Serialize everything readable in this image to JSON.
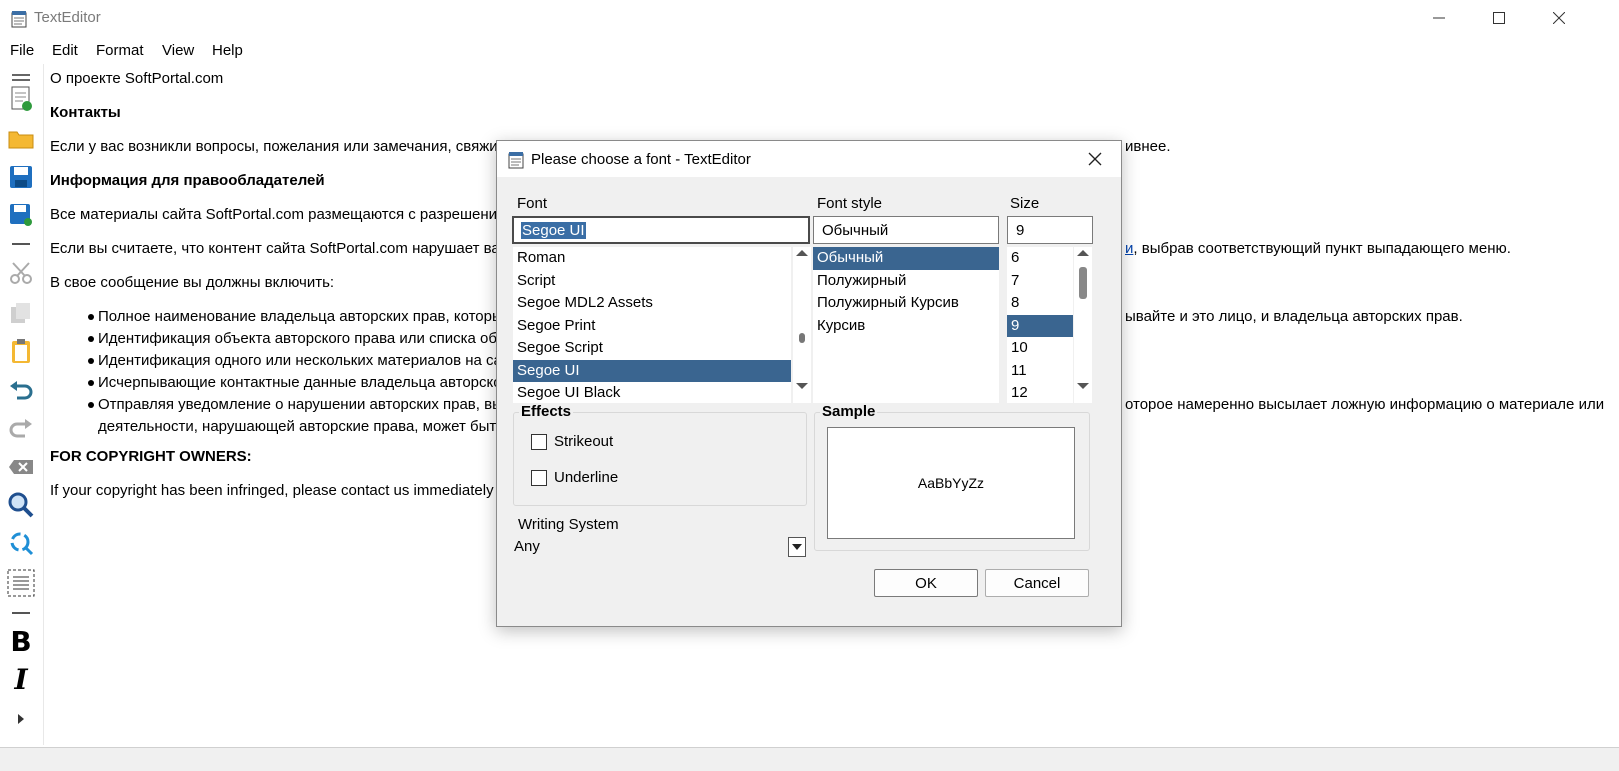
{
  "window": {
    "title": "TextEditor"
  },
  "menu": [
    "File",
    "Edit",
    "Format",
    "View",
    "Help"
  ],
  "toolbar_icons": [
    "hamburger-icon",
    "new-document-icon",
    "open-folder-icon",
    "save-icon",
    "save-as-icon",
    "cut-icon",
    "copy-icon",
    "paste-icon",
    "undo-icon",
    "redo-icon",
    "clear-icon",
    "find-icon",
    "replace-icon",
    "select-all-icon",
    "bold-icon",
    "italic-icon",
    "more-icon"
  ],
  "document": {
    "line1": "О проекте SoftPortal.com",
    "heading1": "Контакты",
    "para1_start": "Если у вас возникли вопросы, пожелания или замечания, свяжит",
    "para1_end": "ивнее.",
    "heading2": "Информация для правообладателей",
    "para2_start": "Все материалы сайта SoftPortal.com размещаются с разрешения",
    "para3_start": "Если вы считаете, что контент сайта SoftPortal.com нарушает ваш",
    "para3_link": "и",
    "para3_end": ", выбрав соответствующий пункт выпадающего меню.",
    "para4": "В свое сообщение вы должны включить:",
    "bullets": [
      {
        "start": "Полное наименование владельца авторских прав, которы",
        "end": "ывайте и это лицо, и владельца авторских прав."
      },
      {
        "start": "Идентификация объекта авторского права или списка об",
        "end": ""
      },
      {
        "start": "Идентификация одного или нескольких материалов на са",
        "end": ""
      },
      {
        "start": "Исчерпывающие контактные данные владельца авторско",
        "end": ""
      },
      {
        "start": "Отправляя уведомление о нарушении авторских прав, вы",
        "end": "оторое намеренно высылает ложную информацию о материале или"
      }
    ],
    "bullet5_line2": "деятельности, нарушающей авторские права, может быть",
    "heading3": "FOR COPYRIGHT OWNERS:",
    "para5_start": "If your copyright has been infringed, please contact us immediately"
  },
  "dialog": {
    "title": "Please choose a font - TextEditor",
    "font_label": "Font",
    "font_value": "Segoe UI",
    "font_list": [
      "Roman",
      "Script",
      "Segoe MDL2 Assets",
      "Segoe Print",
      "Segoe Script",
      "Segoe UI",
      "Segoe UI Black"
    ],
    "font_selected": "Segoe UI",
    "style_label": "Font style",
    "style_value": "Обычный",
    "style_list": [
      "Обычный",
      "Полужирный",
      "Полужирный Курсив",
      "Курсив"
    ],
    "style_selected": "Обычный",
    "size_label": "Size",
    "size_value": "9",
    "size_list": [
      "6",
      "7",
      "8",
      "9",
      "10",
      "11",
      "12"
    ],
    "size_selected": "9",
    "effects_label": "Effects",
    "strikeout_label": "Strikeout",
    "strikeout_checked": false,
    "underline_label": "Underline",
    "underline_checked": false,
    "sample_label": "Sample",
    "sample_text": "AaBbYyZz",
    "writing_system_label": "Writing System",
    "writing_system_value": "Any",
    "ok_label": "OK",
    "cancel_label": "Cancel"
  }
}
